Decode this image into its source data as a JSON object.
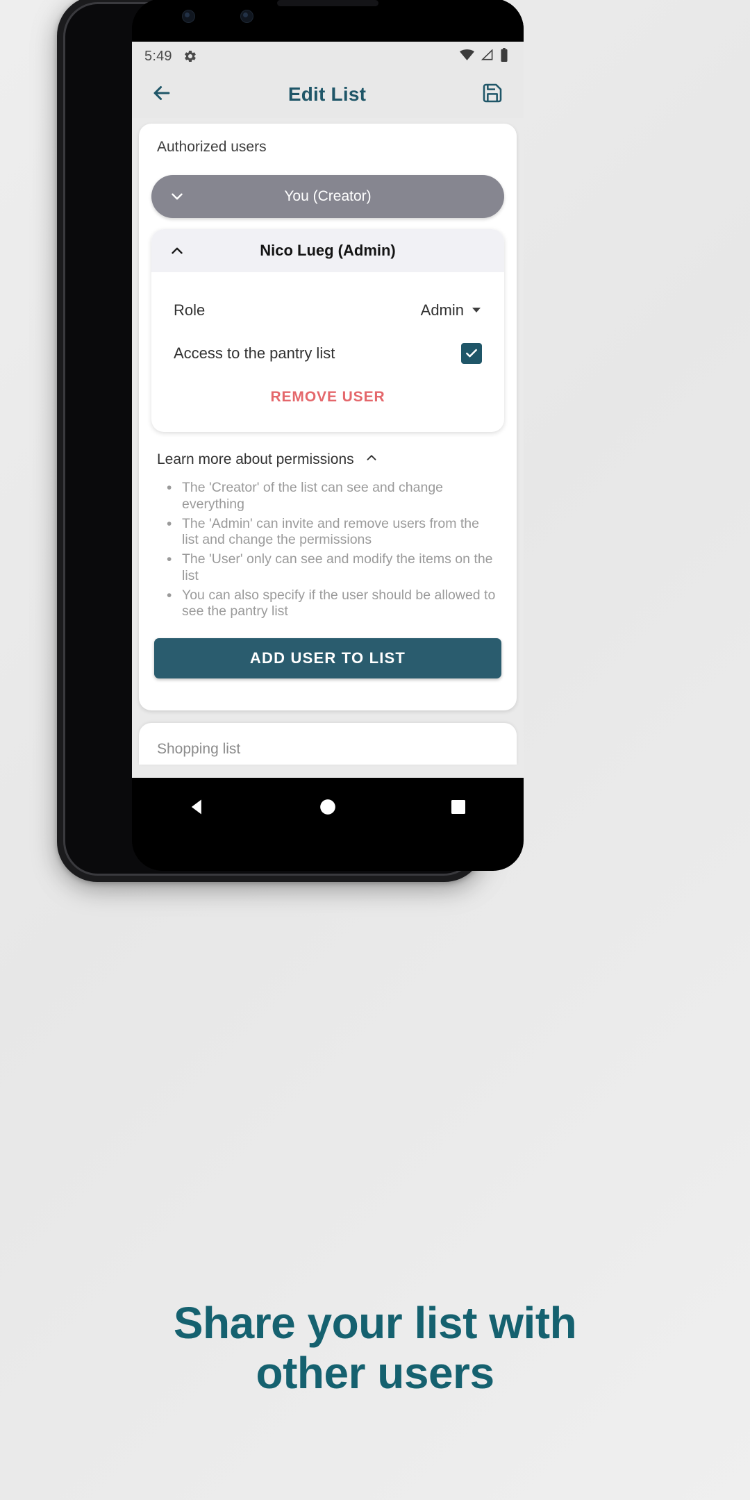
{
  "status_bar": {
    "time": "5:49",
    "gear_icon": "gear-icon",
    "wifi_icon": "wifi-icon",
    "signal_icon": "signal-icon",
    "battery_icon": "battery-icon"
  },
  "app_bar": {
    "back_icon": "arrow-left-icon",
    "title": "Edit List",
    "save_icon": "save-disk-icon"
  },
  "authorized": {
    "section_label": "Authorized users",
    "creator": {
      "name": "You (Creator)",
      "chevron": "chevron-down-icon"
    },
    "member": {
      "name": "Nico Lueg (Admin)",
      "chevron": "chevron-up-icon",
      "role_label": "Role",
      "role_value": "Admin",
      "role_dropdown_icon": "dropdown-caret-icon",
      "pantry_label": "Access to the pantry list",
      "pantry_checked": true,
      "remove_label": "REMOVE USER"
    }
  },
  "learn_more": {
    "title": "Learn more about permissions",
    "chevron": "chevron-up-icon",
    "bullets": [
      "The 'Creator' of the list can see and change everything",
      "The 'Admin' can invite and remove users from the list and change the permissions",
      "The 'User' only can see and modify the items on the list",
      "You can also specify if the user should be allowed to see the pantry list"
    ]
  },
  "add_user": {
    "label": "ADD USER TO LIST"
  },
  "next_card": {
    "label": "Shopping list"
  },
  "nav_bar": {
    "back_icon": "nav-back-triangle-icon",
    "home_icon": "nav-home-circle-icon",
    "recents_icon": "nav-recents-square-icon"
  },
  "caption": {
    "line1": "Share your list with",
    "line2": "other users"
  },
  "colors": {
    "accent_teal": "#1f5668",
    "button_teal": "#2a5c6e",
    "danger_red": "#e4676b",
    "creator_pill_gray": "#868690",
    "caption_teal": "#15616f"
  }
}
